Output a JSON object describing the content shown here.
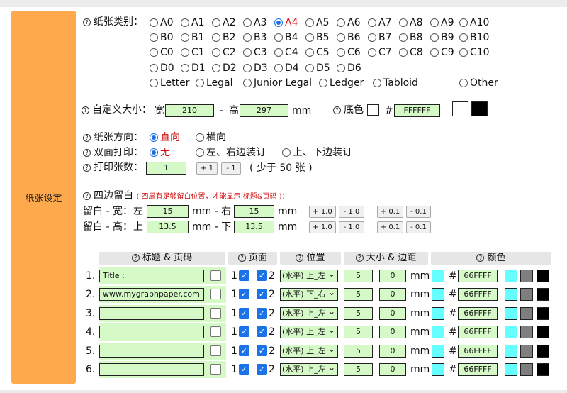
{
  "sidebar": {
    "label": "纸张设定"
  },
  "paper_type": {
    "label": "纸张类别：",
    "selected": "A4",
    "rows": [
      [
        "A0",
        "A1",
        "A2",
        "A3",
        "A4",
        "A5",
        "A6",
        "A7",
        "A8",
        "A9",
        "A10"
      ],
      [
        "B0",
        "B1",
        "B2",
        "B3",
        "B4",
        "B5",
        "B6",
        "B7",
        "B8",
        "B9",
        "B10"
      ],
      [
        "C0",
        "C1",
        "C2",
        "C3",
        "C4",
        "C5",
        "C6",
        "C7",
        "C8",
        "C9",
        "C10"
      ],
      [
        "D0",
        "D1",
        "D2",
        "D3",
        "D4",
        "D5",
        "D6"
      ]
    ],
    "special": [
      "Letter",
      "Legal",
      "Junior Legal",
      "Ledger",
      "Tabloid"
    ],
    "other": "Other"
  },
  "custom_size": {
    "label": "自定义大小：",
    "width_label": "宽",
    "width": "210",
    "dash": "-",
    "height_label": "高",
    "height": "297",
    "unit": "mm",
    "bg_label": "底色",
    "hash": "#",
    "bg_value": "FFFFFF"
  },
  "orientation": {
    "label": "纸张方向：",
    "options": [
      "直向",
      "横向"
    ],
    "selected": "直向"
  },
  "duplex": {
    "label": "双面打印：",
    "options": [
      "无",
      "左、右边装订",
      "上、下边装订"
    ],
    "selected": "无"
  },
  "copies": {
    "label": "打印张数：",
    "value": "1",
    "plus": "+ 1",
    "minus": "- 1",
    "note": "( 少于 50 张 )"
  },
  "margins": {
    "label": "四边留白",
    "note": "( 四周有足够留白位置，才能显示 标题&页码 )：",
    "colon": "：",
    "width_row": {
      "label": "留白 - 宽：",
      "a_label": "左",
      "a_value": "15",
      "mid": "mm - 右",
      "b_value": "15",
      "unit": "mm"
    },
    "height_row": {
      "label": "留白 - 高：",
      "a_label": "上",
      "a_value": "13.5",
      "mid": "mm - 下",
      "b_value": "13.5",
      "unit": "mm"
    },
    "buttons": [
      "+ 1.0",
      "- 1.0",
      "+ 0.1",
      "- 0.1"
    ]
  },
  "header_table": {
    "headers": [
      "标题 & 页码",
      "页面",
      "位置",
      "大小 & 边距",
      "颜色"
    ],
    "page1": "1",
    "page2": "2",
    "unit": "mm",
    "hash": "#",
    "colors": {
      "cyan": "#66ffff",
      "gray": "#7f7f7f",
      "black": "#000000",
      "input_green": "#d6f9c8",
      "accent": "#ffa94d"
    },
    "rows": [
      {
        "num": "1.",
        "title": "Title :",
        "position": "(水平) 上_左",
        "size": "5",
        "margin": "0",
        "color": "66FFFF"
      },
      {
        "num": "2.",
        "title": "www.mygraphpaper.com",
        "position": "(水平) 下_右",
        "size": "5",
        "margin": "0",
        "color": "66FFFF"
      },
      {
        "num": "3.",
        "title": "",
        "position": "(水平) 上_左",
        "size": "5",
        "margin": "0",
        "color": "66FFFF"
      },
      {
        "num": "4.",
        "title": "",
        "position": "(水平) 上_左",
        "size": "5",
        "margin": "0",
        "color": "66FFFF"
      },
      {
        "num": "5.",
        "title": "",
        "position": "(水平) 上_左",
        "size": "5",
        "margin": "0",
        "color": "66FFFF"
      },
      {
        "num": "6.",
        "title": "",
        "position": "(水平) 上_左",
        "size": "5",
        "margin": "0",
        "color": "66FFFF"
      }
    ]
  }
}
